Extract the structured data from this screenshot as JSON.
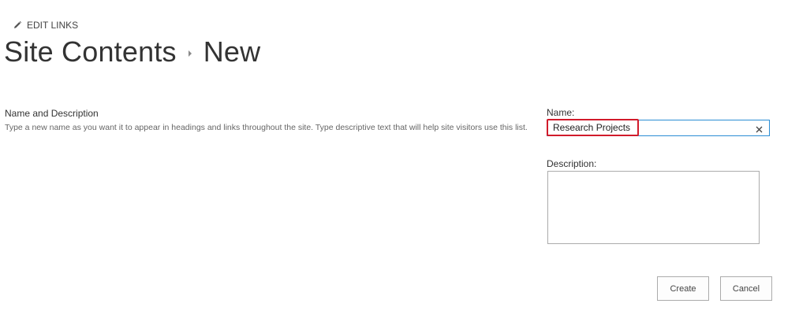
{
  "toolbar": {
    "edit_links_label": "EDIT LINKS",
    "edit_icon": "pencil-icon"
  },
  "breadcrumb": {
    "parent": "Site Contents",
    "separator_icon": "caret-right-icon",
    "current": "New"
  },
  "section": {
    "title": "Name and Description",
    "description": "Type a new name as you want it to appear in headings and links throughout the site. Type descriptive text that will help site visitors use this list."
  },
  "form": {
    "name_label": "Name:",
    "name_value": "Research Projects",
    "clear_icon": "close-icon",
    "description_label": "Description:",
    "description_value": ""
  },
  "actions": {
    "create_label": "Create",
    "cancel_label": "Cancel"
  },
  "colors": {
    "input_focus_border": "#2a8dd4",
    "highlight_border": "#d11b2b"
  }
}
